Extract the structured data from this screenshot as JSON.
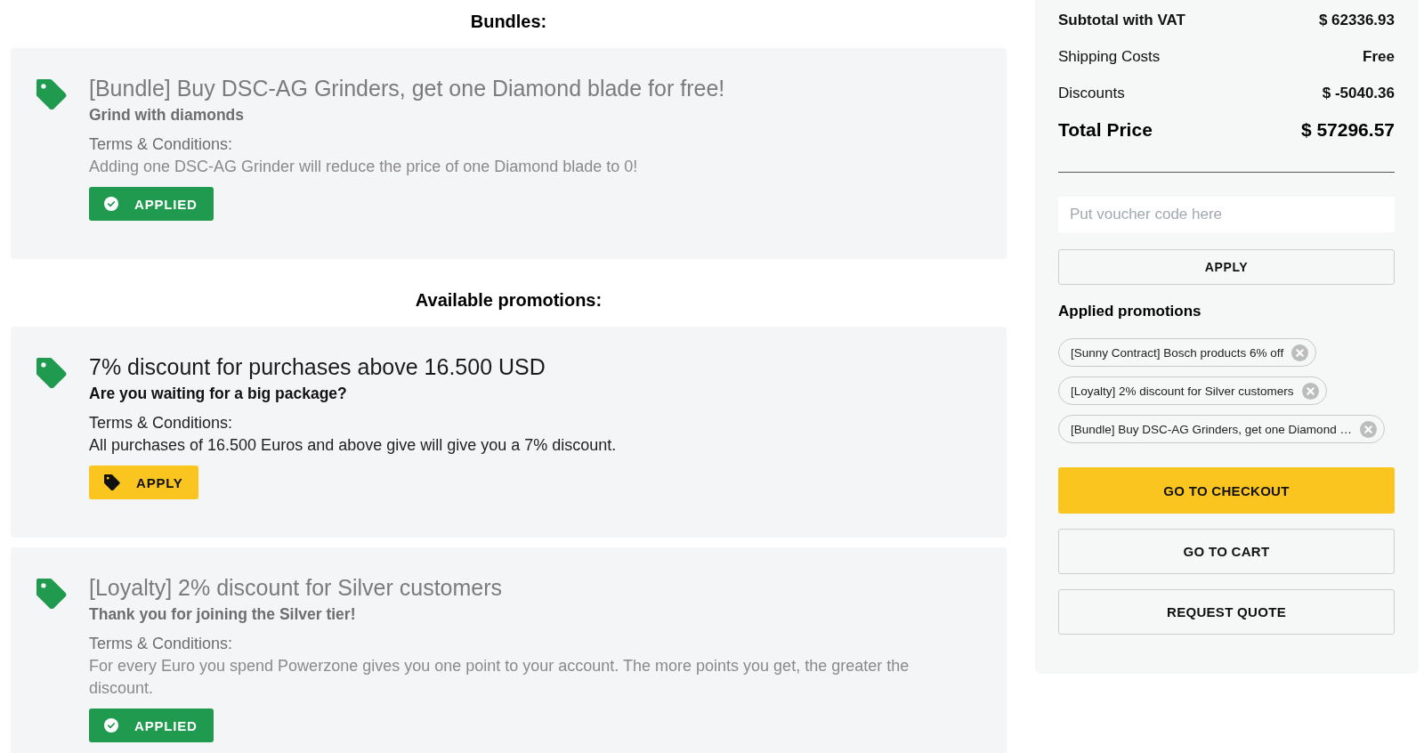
{
  "sections": [
    {
      "heading": "Bundles:",
      "promotions": [
        {
          "title": "[Bundle] Buy DSC-AG Grinders, get one Diamond blade for free!",
          "subtitle": "Grind with diamonds",
          "terms_label": "Terms & Conditions:",
          "terms": "Adding one DSC-AG Grinder will reduce the price of one Diamond blade to 0!",
          "applied": true,
          "button": "APPLIED"
        }
      ]
    },
    {
      "heading": "Available promotions:",
      "promotions": [
        {
          "title": "7% discount for purchases above 16.500 USD",
          "subtitle": "Are you waiting for a big package?",
          "terms_label": "Terms & Conditions:",
          "terms": "All purchases of 16.500 Euros and above give will give you a 7% discount.",
          "applied": false,
          "button": "APPLY"
        },
        {
          "title": "[Loyalty] 2% discount for Silver customers",
          "subtitle": "Thank you for joining the Silver tier!",
          "terms_label": "Terms & Conditions:",
          "terms": "For every Euro you spend Powerzone gives you one point to your account. The more points you get, the greater the discount.",
          "applied": true,
          "button": "APPLIED"
        }
      ]
    }
  ],
  "summary": {
    "rows": [
      {
        "kind": "subtotal",
        "label": "Subtotal with VAT",
        "value": "$ 62336.93"
      },
      {
        "kind": "line",
        "label": "Shipping Costs",
        "value": "Free"
      },
      {
        "kind": "line",
        "label": "Discounts",
        "value": "$ -5040.36"
      },
      {
        "kind": "total",
        "label": "Total Price",
        "value": "$ 57296.57"
      }
    ],
    "voucher": {
      "placeholder": "Put voucher code here"
    },
    "voucher_button": "APPLY",
    "applied_heading": "Applied promotions",
    "applied_promotions": [
      {
        "label": "[Sunny Contract] Bosch products 6% off"
      },
      {
        "label": "[Loyalty] 2% discount for Silver customers"
      },
      {
        "label": "[Bundle] Buy DSC-AG Grinders, get one Diamond …"
      }
    ],
    "actions": [
      {
        "kind": "primary",
        "label": "GO TO CHECKOUT"
      },
      {
        "kind": "secondary",
        "label": "GO TO CART"
      },
      {
        "kind": "secondary",
        "label": "REQUEST QUOTE"
      }
    ]
  }
}
